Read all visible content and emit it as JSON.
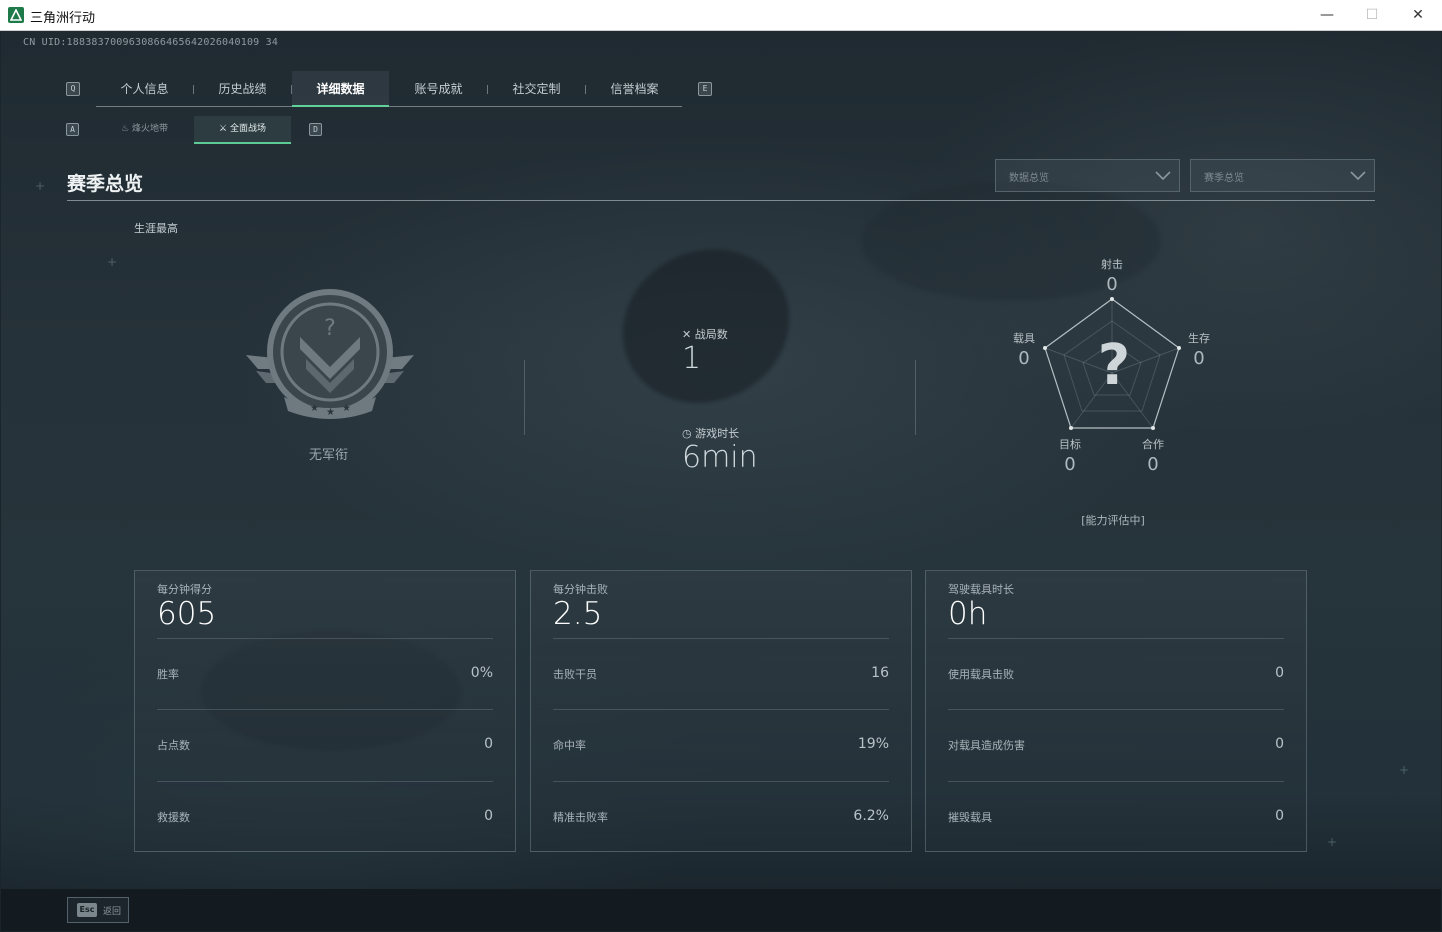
{
  "window": {
    "title": "三角洲行动",
    "minimize": "—",
    "maximize": "☐",
    "close": "✕"
  },
  "uid": "CN UID:1883837009630866465642026040109 34",
  "main_tabs": {
    "left_key": "Q",
    "right_key": "E",
    "items": [
      {
        "label": "个人信息",
        "active": false
      },
      {
        "label": "历史战绩",
        "active": false
      },
      {
        "label": "详细数据",
        "active": true
      },
      {
        "label": "账号成就",
        "active": false
      },
      {
        "label": "社交定制",
        "active": false
      },
      {
        "label": "信誉档案",
        "active": false
      }
    ]
  },
  "sub_tabs": {
    "left_key": "A",
    "right_key": "D",
    "items": [
      {
        "label": "烽火地带",
        "active": false,
        "icon": "flame-icon"
      },
      {
        "label": "全面战场",
        "active": true,
        "icon": "crossed-arrows-icon"
      }
    ]
  },
  "section": {
    "title": "赛季总览",
    "dropdown_1": "数据总览",
    "dropdown_2": "赛季总览"
  },
  "career": {
    "label": "生涯最高",
    "rank_label": "无军衔"
  },
  "center_stats": {
    "matches_label": "战局数",
    "matches_value": "1",
    "playtime_label": "游戏时长",
    "playtime_value": "6min"
  },
  "radar": {
    "center_mark": "?",
    "axes": [
      {
        "label": "射击",
        "value": "0"
      },
      {
        "label": "生存",
        "value": "0"
      },
      {
        "label": "合作",
        "value": "0"
      },
      {
        "label": "目标",
        "value": "0"
      },
      {
        "label": "载具",
        "value": "0"
      }
    ],
    "note": "[能力评估中]"
  },
  "cards": [
    {
      "label": "每分钟得分",
      "value": "605",
      "rows": [
        {
          "label": "胜率",
          "value": "0%"
        },
        {
          "label": "占点数",
          "value": "0"
        },
        {
          "label": "救援数",
          "value": "0"
        }
      ]
    },
    {
      "label": "每分钟击败",
      "value": "2.5",
      "rows": [
        {
          "label": "击败干员",
          "value": "16"
        },
        {
          "label": "命中率",
          "value": "19%"
        },
        {
          "label": "精准击败率",
          "value": "6.2%"
        }
      ]
    },
    {
      "label": "驾驶载具时长",
      "value": "0h",
      "rows": [
        {
          "label": "使用载具击败",
          "value": "0"
        },
        {
          "label": "对载具造成伤害",
          "value": "0"
        },
        {
          "label": "摧毁载具",
          "value": "0"
        }
      ]
    }
  ],
  "bottom": {
    "esc_key": "Esc",
    "esc_label": "返回"
  },
  "colors": {
    "accent": "#62d09a",
    "background": "#22313a"
  }
}
